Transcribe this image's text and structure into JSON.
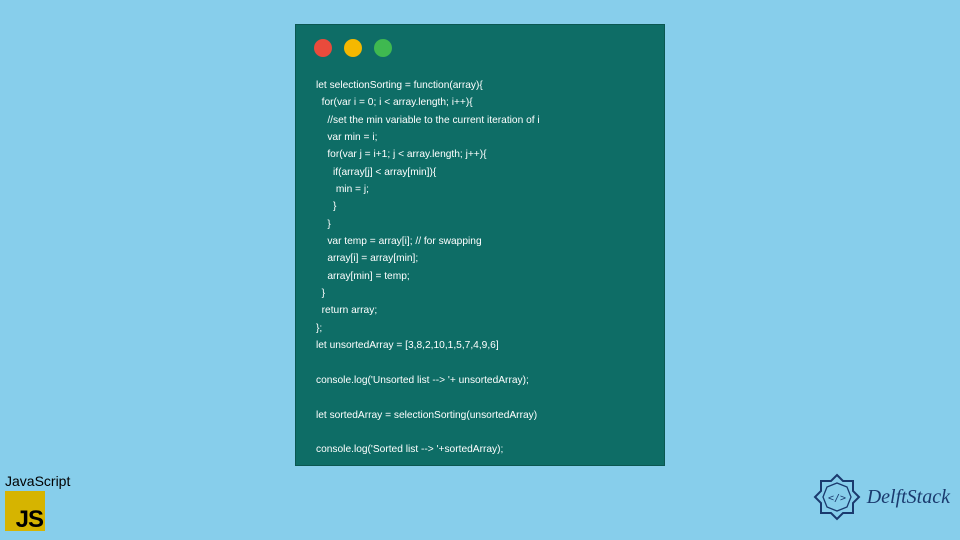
{
  "window": {
    "traffic_lights": {
      "red": "#e94b3c",
      "yellow": "#f5b800",
      "green": "#3fb950"
    }
  },
  "code": {
    "lines": "let selectionSorting = function(array){\n  for(var i = 0; i < array.length; i++){\n    //set the min variable to the current iteration of i\n    var min = i;\n    for(var j = i+1; j < array.length; j++){\n      if(array[j] < array[min]){\n       min = j;\n      }\n    }\n    var temp = array[i]; // for swapping\n    array[i] = array[min];\n    array[min] = temp;\n  }\n  return array;\n};\nlet unsortedArray = [3,8,2,10,1,5,7,4,9,6]\n\nconsole.log('Unsorted list --> '+ unsortedArray);\n\nlet sortedArray = selectionSorting(unsortedArray)\n\nconsole.log('Sorted list --> '+sortedArray);"
  },
  "badges": {
    "js_label": "JavaScript",
    "js_letters": "JS",
    "delft_text": "DelftStack"
  },
  "colors": {
    "background": "#87ceeb",
    "window_bg": "#0e6d66",
    "js_logo_bg": "#d6b400",
    "delft_blue": "#1a3a6e"
  }
}
